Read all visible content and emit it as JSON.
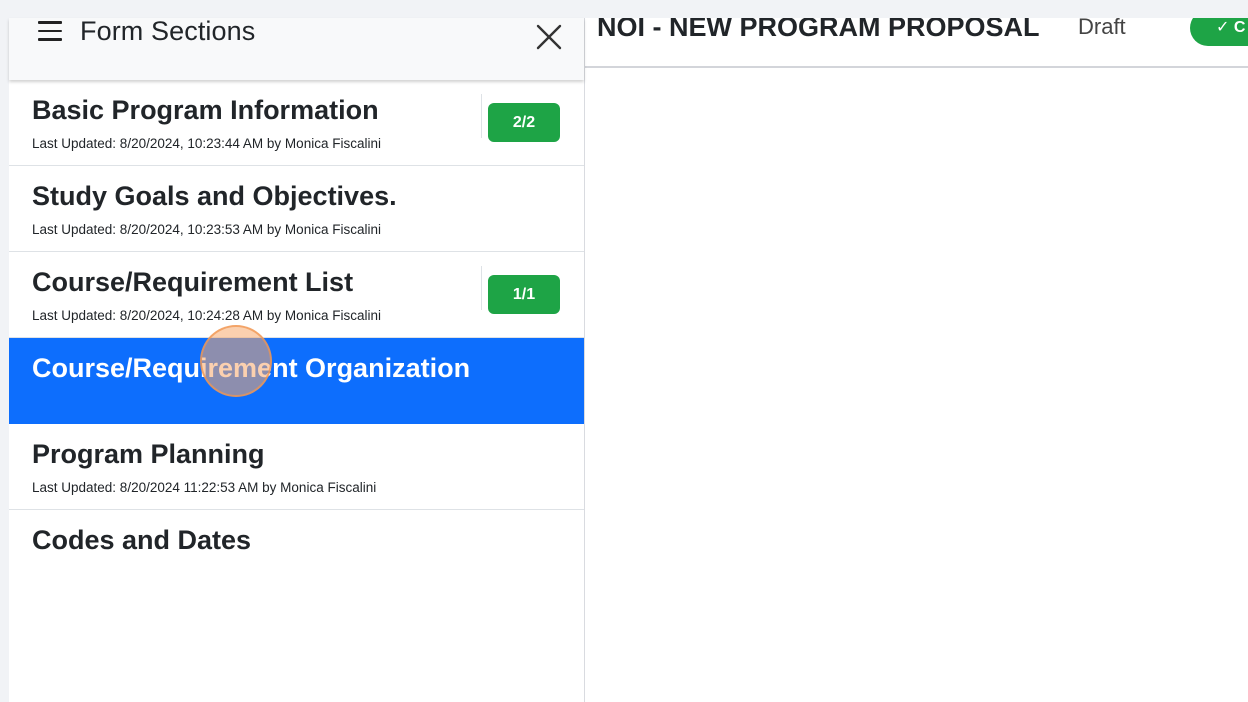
{
  "sidebar": {
    "title": "Form Sections",
    "sections": [
      {
        "name": "Basic Program Information",
        "last_updated": "Last Updated: 8/20/2024, 10:23:44 AM by Monica Fiscalini",
        "badge": "2/2"
      },
      {
        "name": "Study Goals and Objectives.",
        "last_updated": "Last Updated: 8/20/2024, 10:23:53 AM by Monica Fiscalini"
      },
      {
        "name": "Course/Requirement List",
        "last_updated": "Last Updated: 8/20/2024, 10:24:28 AM by Monica Fiscalini",
        "badge": "1/1"
      },
      {
        "name": "Course/Requirement Organization",
        "active": true
      },
      {
        "name": "Program Planning",
        "last_updated": "Last Updated: 8/20/2024 11:22:53 AM by Monica Fiscalini"
      },
      {
        "name": "Codes and Dates"
      }
    ]
  },
  "main": {
    "title": "NOI - NEW PROGRAM PROPOSAL",
    "status": "Draft",
    "action_label": "✓ C"
  },
  "colors": {
    "active_item": "#0d6efd",
    "badge_green": "#1ea446",
    "cursor_highlight": "#f7aa6e"
  },
  "icons": {
    "menu": "hamburger-icon",
    "close": "close-icon",
    "check": "check-icon"
  }
}
